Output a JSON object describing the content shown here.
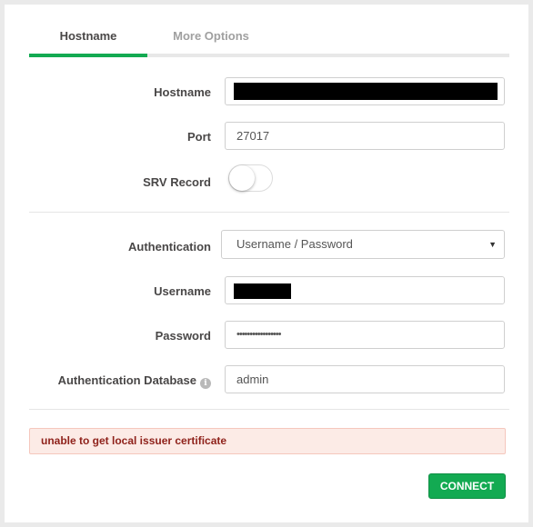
{
  "tabs": [
    {
      "label": "Hostname"
    },
    {
      "label": "More Options"
    }
  ],
  "fields": {
    "hostname": {
      "label": "Hostname",
      "value": ""
    },
    "port": {
      "label": "Port",
      "value": "27017"
    },
    "srv": {
      "label": "SRV Record",
      "enabled": false
    },
    "authentication": {
      "label": "Authentication",
      "selected": "Username / Password"
    },
    "username": {
      "label": "Username",
      "value": ""
    },
    "password": {
      "label": "Password",
      "value": "•••••••••••••••••"
    },
    "auth_db": {
      "label": "Authentication Database",
      "value": "admin"
    }
  },
  "error": {
    "message": "unable to get local issuer certificate"
  },
  "connect_label": "CONNECT",
  "colors": {
    "accent": "#13aa52",
    "error_bg": "#fcebe6",
    "error_text": "#8f221b"
  }
}
